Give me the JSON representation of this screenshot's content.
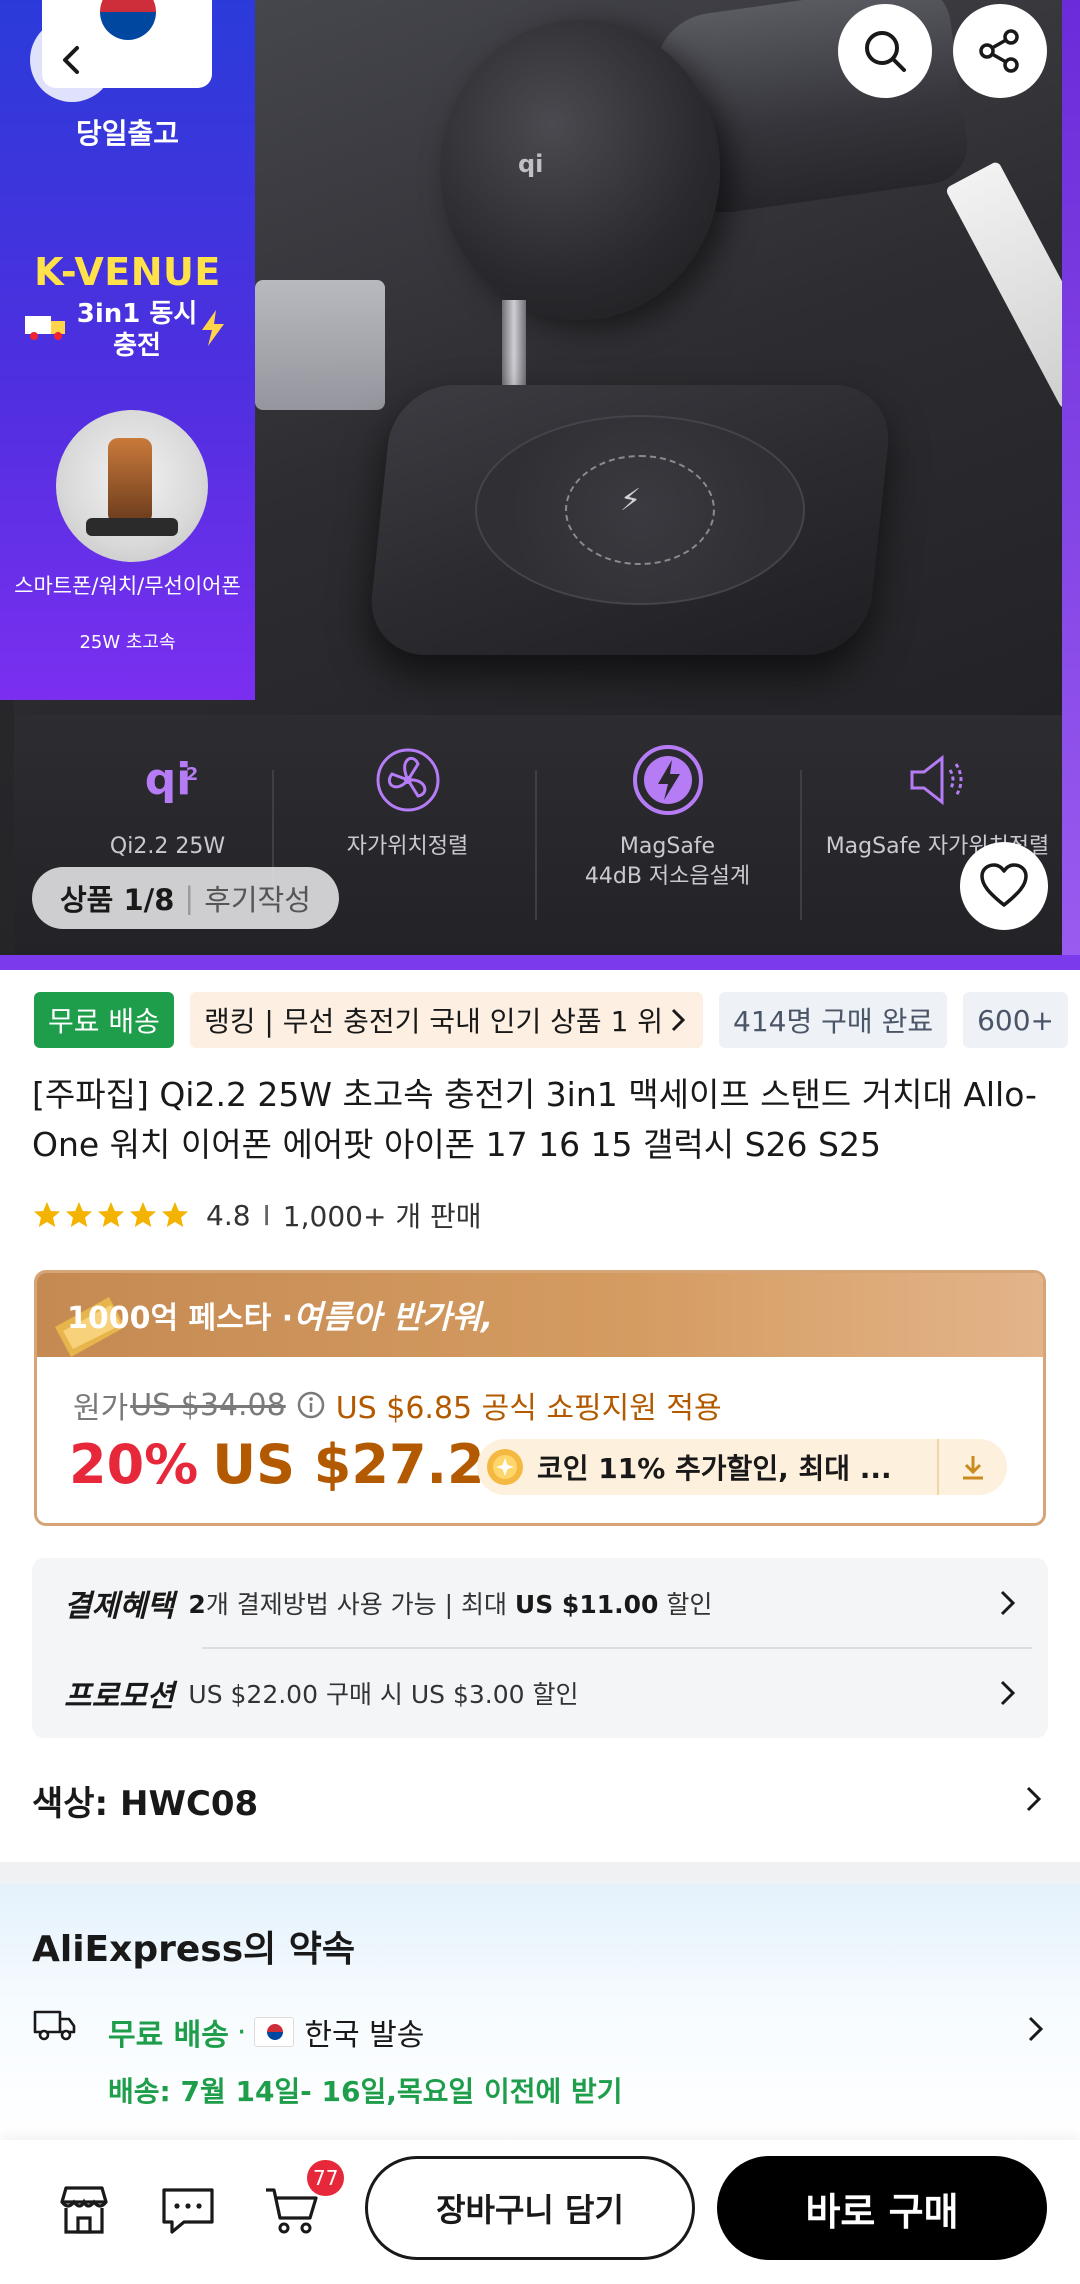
{
  "hero": {
    "promo": {
      "same_day": "당일출고",
      "brand": "K-VENUE",
      "headline": "3in1 동시 충전",
      "devices": "스마트폰/워치/무선이어폰",
      "speed": "25W 초고속"
    },
    "charger_logo": "qi",
    "features": [
      {
        "icon": "qi2-icon",
        "label": "Qi2.2 25W"
      },
      {
        "icon": "fan-icon",
        "label": "자가위치정렬"
      },
      {
        "icon": "magsafe-bolt-icon",
        "label": "MagSafe\n44dB 저소음설계"
      },
      {
        "icon": "speaker-icon",
        "label": "MagSafe 자가위치정렬"
      }
    ],
    "counter": {
      "current": "상품 1/8",
      "separator": "|",
      "review": "후기작성"
    }
  },
  "tags": [
    {
      "label": "무료 배송"
    },
    {
      "label": "랭킹 | 무선 충전기 국내 인기 상품 1 위"
    },
    {
      "label": "414명 구매 완료"
    },
    {
      "label": "600+"
    }
  ],
  "product": {
    "title": "[주파집] Qi2.2 25W 초고속 충전기 3in1 맥세이프 스탠드 거치대 Allo-One 워치 이어폰 에어팟 아이폰 17 16 15 갤럭시 S26 S25",
    "rating": "4.8",
    "rating_sep": "I",
    "sold": "1,000+ 개 판매",
    "stars": 5
  },
  "price": {
    "banner": "1000억 페스타 · ",
    "banner_italic": "여름아 반가워,",
    "original_label": "원가",
    "original_price": "US $34.08",
    "promo_text": "US $6.85 공식 쇼핑지원 적용",
    "discount": "20%",
    "sale_price": "US $27.23",
    "coin_text": "코인 11% 추가할인, 최대 ..."
  },
  "benefits": [
    {
      "label": "결제혜택",
      "desc_bold1": "2",
      "desc_mid": "개 결제방법 사용 가능 | 최대 ",
      "desc_bold2": "US $11.00",
      "desc_end": " 할인"
    },
    {
      "label": "프로모션",
      "desc": "US $22.00 구매 시 US $3.00 할인"
    }
  ],
  "color": {
    "label": "색상: HWC08"
  },
  "promise": {
    "title": "AliExpress의 약속",
    "ship_free": "무료 배송",
    "ship_dot": "·",
    "ship_from": "한국 발송",
    "ship_date": "배송: 7월 14일- 16일,목요일 이전에 받기"
  },
  "bottom_bar": {
    "cart_count": "77",
    "add_to_cart": "장바구니 담기",
    "buy_now": "바로 구매"
  },
  "colors": {
    "green": "#1e9e4a",
    "red": "#e6283a",
    "price_brown": "#b35a00",
    "promo_blue": "#2b3bd9",
    "promo_purple": "#7b2ff0"
  }
}
